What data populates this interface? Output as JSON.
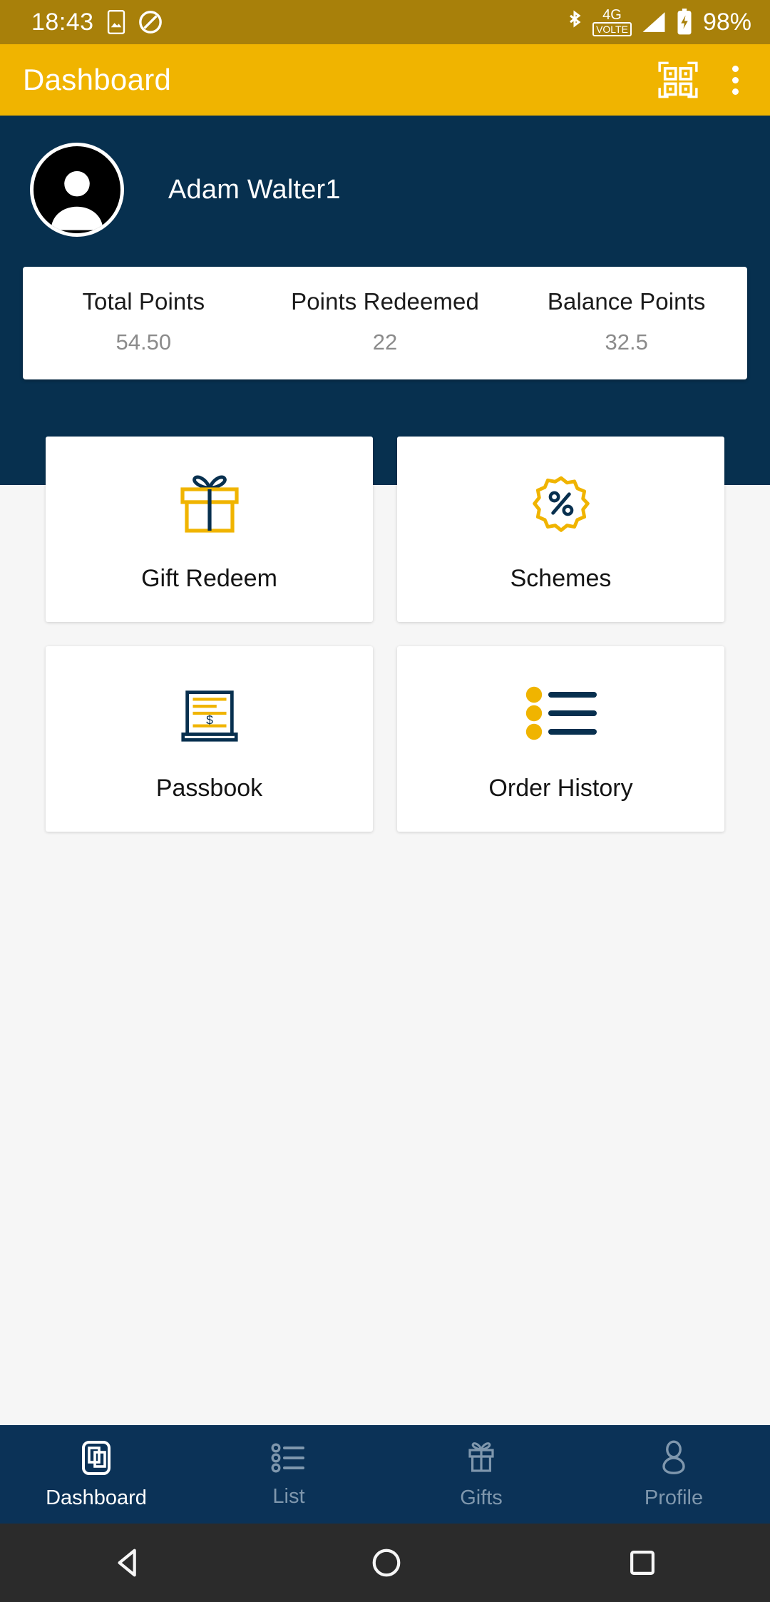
{
  "status_bar": {
    "time": "18:43",
    "battery_percent": "98%",
    "network_label_top": "4G",
    "network_label_bottom": "VOLTE",
    "icons": [
      "screenshot-icon",
      "do-not-disturb-icon",
      "bluetooth-icon",
      "volte-icon",
      "signal-icon",
      "battery-icon"
    ],
    "bg_color": "#a8800a"
  },
  "app_bar": {
    "title": "Dashboard",
    "scan_icon": "qr-scanner-icon",
    "overflow_icon": "more-vertical-icon",
    "bg_color": "#f0b400",
    "title_color": "#ffffff"
  },
  "hero": {
    "bg_color": "#07304f",
    "avatar_icon": "user-avatar-icon",
    "user_name": "Adam Walter1",
    "stats": [
      {
        "label": "Total Points",
        "value": "54.50"
      },
      {
        "label": "Points Redeemed",
        "value": "22"
      },
      {
        "label": "Balance Points",
        "value": "32.5"
      }
    ]
  },
  "tiles": [
    {
      "label": "Gift Redeem",
      "icon": "gift-icon"
    },
    {
      "label": "Schemes",
      "icon": "discount-badge-icon"
    },
    {
      "label": "Passbook",
      "icon": "passbook-icon"
    },
    {
      "label": "Order History",
      "icon": "order-list-icon"
    }
  ],
  "bottom_nav": {
    "bg_color": "#0b3257",
    "active_color": "#ffffff",
    "inactive_color": "#7f97ad",
    "items": [
      {
        "label": "Dashboard",
        "icon": "dashboard-icon",
        "active": true
      },
      {
        "label": "List",
        "icon": "list-icon",
        "active": false
      },
      {
        "label": "Gifts",
        "icon": "gift-outline-icon",
        "active": false
      },
      {
        "label": "Profile",
        "icon": "person-outline-icon",
        "active": false
      }
    ]
  },
  "android_nav": {
    "bg_color": "#2b2b2b",
    "back_icon": "triangle-back-icon",
    "home_icon": "circle-home-icon",
    "recents_icon": "square-recents-icon"
  },
  "theme": {
    "gold": "#f0b400",
    "navy": "#07304f",
    "page_bg": "#f6f6f6"
  }
}
